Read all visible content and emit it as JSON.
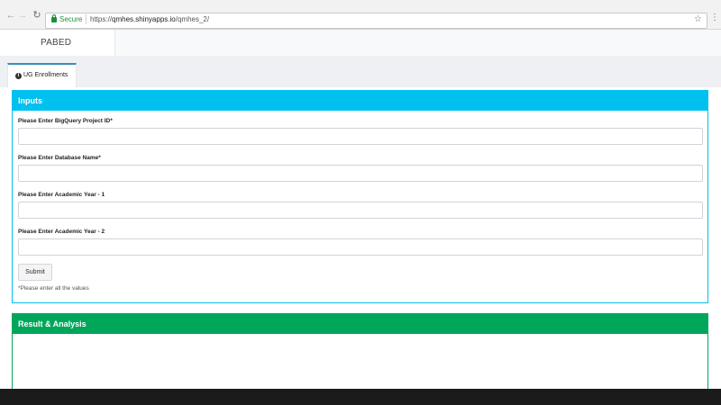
{
  "browser": {
    "secure_label": "Secure",
    "url_scheme": "https://",
    "url_host": "qmhes.shinyapps.io",
    "url_path": "/qmhes_2/"
  },
  "app": {
    "brand": "PABED"
  },
  "tabs": [
    {
      "label": "UG Enrollments",
      "icon": "info-circle-icon",
      "active": true
    }
  ],
  "inputs_box": {
    "title": "Inputs",
    "header_color": "#00c0ef",
    "fields": [
      {
        "label": "Please Enter BigQuery Project ID*",
        "value": ""
      },
      {
        "label": "Please Enter Database Name*",
        "value": ""
      },
      {
        "label": "Please Enter Academic Year - 1",
        "value": ""
      },
      {
        "label": "Please Enter Academic Year - 2",
        "value": ""
      }
    ],
    "submit_label": "Submit",
    "hint": "*Please enter all the values"
  },
  "result_box": {
    "title": "Result & Analysis",
    "header_color": "#00a65a"
  },
  "colors": {
    "tab_accent": "#3c8dbc",
    "secure_green": "#1f8f3a"
  }
}
